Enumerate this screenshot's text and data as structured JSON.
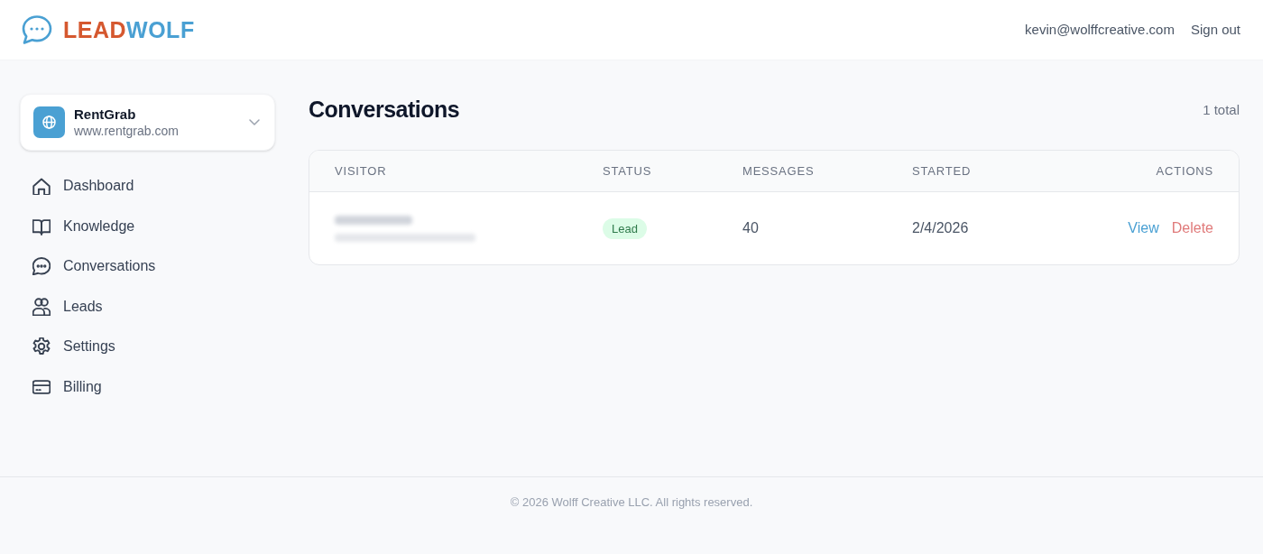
{
  "header": {
    "logo": {
      "parts": [
        {
          "text": "LEAD",
          "color": "#d5582f"
        },
        {
          "text": "WOLF",
          "color": "#4aa0d3"
        }
      ]
    },
    "user_email": "kevin@wolffcreative.com",
    "sign_out": "Sign out"
  },
  "site_selector": {
    "name": "RentGrab",
    "url": "www.rentgrab.com"
  },
  "sidebar": {
    "items": [
      {
        "label": "Dashboard"
      },
      {
        "label": "Knowledge"
      },
      {
        "label": "Conversations"
      },
      {
        "label": "Leads"
      },
      {
        "label": "Settings"
      },
      {
        "label": "Billing"
      }
    ]
  },
  "page": {
    "title": "Conversations",
    "count": "1 total"
  },
  "table": {
    "columns": [
      "VISITOR",
      "STATUS",
      "MESSAGES",
      "STARTED",
      "ACTIONS"
    ],
    "rows": [
      {
        "status": "Lead",
        "messages": "40",
        "started": "2/4/2026",
        "actions": [
          {
            "label": "View",
            "kind": "view"
          },
          {
            "label": "Delete",
            "kind": "delete"
          }
        ]
      }
    ]
  },
  "footer": {
    "text": "© 2026 Wolff Creative LLC. All rights reserved."
  }
}
